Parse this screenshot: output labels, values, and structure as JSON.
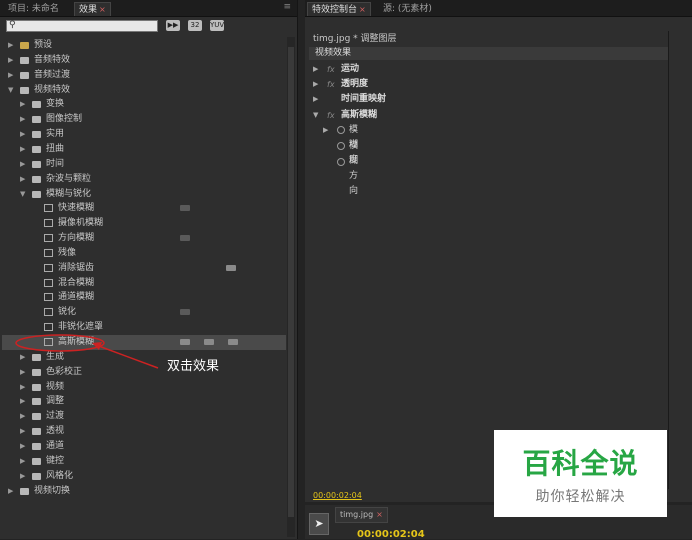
{
  "left_panel": {
    "tabs": [
      "项目: 未命名",
      "效果"
    ],
    "menu_icon": "≡",
    "search": {
      "value": "",
      "placeholder": ""
    },
    "tools": [
      "32",
      "32",
      "YUV"
    ],
    "tree": [
      {
        "label": "预设",
        "level": 0,
        "type": "folder",
        "expanded": false
      },
      {
        "label": "音频特效",
        "level": 0,
        "type": "folder",
        "expanded": false
      },
      {
        "label": "音频过渡",
        "level": 0,
        "type": "folder",
        "expanded": false
      },
      {
        "label": "视频特效",
        "level": 0,
        "type": "folder",
        "expanded": true
      },
      {
        "label": "变换",
        "level": 1,
        "type": "folder",
        "expanded": false
      },
      {
        "label": "图像控制",
        "level": 1,
        "type": "folder",
        "expanded": false
      },
      {
        "label": "实用",
        "level": 1,
        "type": "folder",
        "expanded": false
      },
      {
        "label": "扭曲",
        "level": 1,
        "type": "folder",
        "expanded": false
      },
      {
        "label": "时间",
        "level": 1,
        "type": "folder",
        "expanded": false
      },
      {
        "label": "杂波与颗粒",
        "level": 1,
        "type": "folder",
        "expanded": false
      },
      {
        "label": "模糊与锐化",
        "level": 1,
        "type": "folder",
        "expanded": true
      },
      {
        "label": "快速模糊",
        "level": 2,
        "type": "effect"
      },
      {
        "label": "摄像机模糊",
        "level": 2,
        "type": "effect"
      },
      {
        "label": "方向模糊",
        "level": 2,
        "type": "effect"
      },
      {
        "label": "残像",
        "level": 2,
        "type": "effect"
      },
      {
        "label": "消除锯齿",
        "level": 2,
        "type": "effect"
      },
      {
        "label": "混合模糊",
        "level": 2,
        "type": "effect"
      },
      {
        "label": "通道模糊",
        "level": 2,
        "type": "effect"
      },
      {
        "label": "锐化",
        "level": 2,
        "type": "effect"
      },
      {
        "label": "非锐化遮罩",
        "level": 2,
        "type": "effect"
      },
      {
        "label": "高斯模糊",
        "level": 2,
        "type": "effect",
        "selected": true
      },
      {
        "label": "生成",
        "level": 1,
        "type": "folder",
        "expanded": false
      },
      {
        "label": "色彩校正",
        "level": 1,
        "type": "folder",
        "expanded": false
      },
      {
        "label": "视频",
        "level": 1,
        "type": "folder",
        "expanded": false
      },
      {
        "label": "调整",
        "level": 1,
        "type": "folder",
        "expanded": false
      },
      {
        "label": "过渡",
        "level": 1,
        "type": "folder",
        "expanded": false
      },
      {
        "label": "透视",
        "level": 1,
        "type": "folder",
        "expanded": false
      },
      {
        "label": "通道",
        "level": 1,
        "type": "folder",
        "expanded": false
      },
      {
        "label": "键控",
        "level": 1,
        "type": "folder",
        "expanded": false
      },
      {
        "label": "风格化",
        "level": 1,
        "type": "folder",
        "expanded": false
      },
      {
        "label": "视频切换",
        "level": 0,
        "type": "folder",
        "expanded": false
      }
    ]
  },
  "annotation": {
    "text": "双击效果",
    "color": "#cc2222"
  },
  "right_panel": {
    "tabs": [
      "特效控制台",
      "源: (无素材)"
    ],
    "clip_title": "timg.jpg * 调整图层",
    "section_header": "视频效果",
    "effects": [
      {
        "label": "运动",
        "fx": "fx"
      },
      {
        "label": "透明度",
        "fx": "fx"
      },
      {
        "label": "时间重映射",
        "fx": ""
      },
      {
        "label": "高斯模糊",
        "fx": "fx",
        "expanded": true
      }
    ],
    "properties": [
      {
        "label": "模糊度"
      },
      {
        "label": "模糊方向"
      },
      {
        "label": ""
      }
    ],
    "timecode": "00:00:02:04"
  },
  "bottom_panel": {
    "tab": "timg.jpg",
    "timecode": "00:00:02:04"
  },
  "watermark": {
    "title": "百科全说",
    "subtitle": "助你轻松解决",
    "color": "#27a644"
  }
}
